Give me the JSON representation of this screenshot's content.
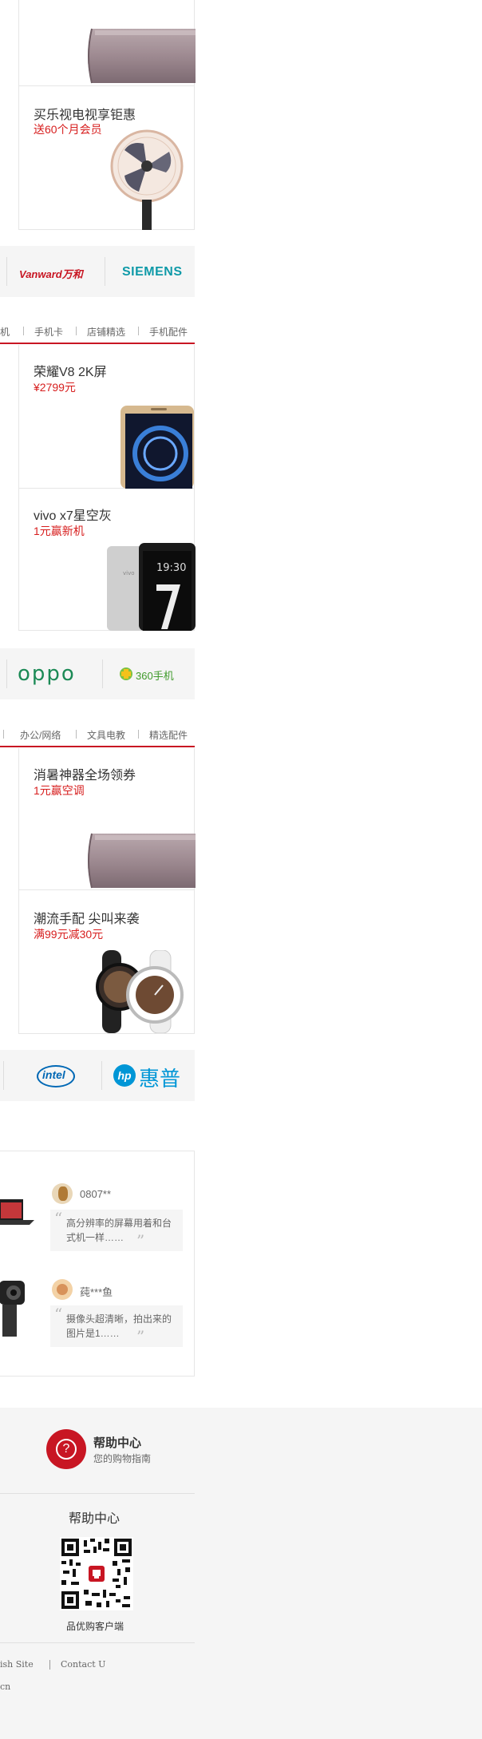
{
  "section1": {
    "items": [
      {
        "title": "",
        "subtitle": ""
      },
      {
        "title": "买乐视电视享钜惠",
        "subtitle": "送60个月会员"
      }
    ],
    "brands": [
      "Vanward万和",
      "SIEMENS"
    ]
  },
  "section2": {
    "tabs": [
      "机",
      "手机卡",
      "店铺精选",
      "手机配件"
    ],
    "items": [
      {
        "title": "荣耀V8 2K屏",
        "subtitle": "¥2799元"
      },
      {
        "title": "vivo x7星空灰",
        "subtitle": "1元赢新机"
      }
    ],
    "brands": [
      "oppo",
      "360手机"
    ]
  },
  "section3": {
    "tabs": [
      "",
      "办公/网络",
      "文具电教",
      "精选配件"
    ],
    "items": [
      {
        "title": "消暑神器全场领券",
        "subtitle": "1元赢空调"
      },
      {
        "title": "潮流手配 尖叫来袭",
        "subtitle": "满99元减30元"
      }
    ],
    "brands": [
      "intel",
      "惠普"
    ],
    "hp_letter": "hp"
  },
  "reviews": [
    {
      "name": "0807**",
      "text": "高分辨率的屏幕用着和台式机一样……"
    },
    {
      "name": "莼***鱼",
      "text": "摄像头超清晰，拍出来的图片是1……"
    }
  ],
  "footer": {
    "help_icon_glyph": "?",
    "help_title": "帮助中心",
    "help_subtitle": "您的购物指南",
    "qr_title": "帮助中心",
    "qr_caption": "品优购客户端",
    "links": [
      "ish Site",
      "Contact U"
    ],
    "bottom_text": "cn"
  },
  "colors": {
    "accent": "#c81623",
    "price": "#d71e1e",
    "siemens": "#0f9aa8",
    "oppo": "#1c8a56",
    "hp": "#0096d6",
    "intel": "#0068b5"
  }
}
